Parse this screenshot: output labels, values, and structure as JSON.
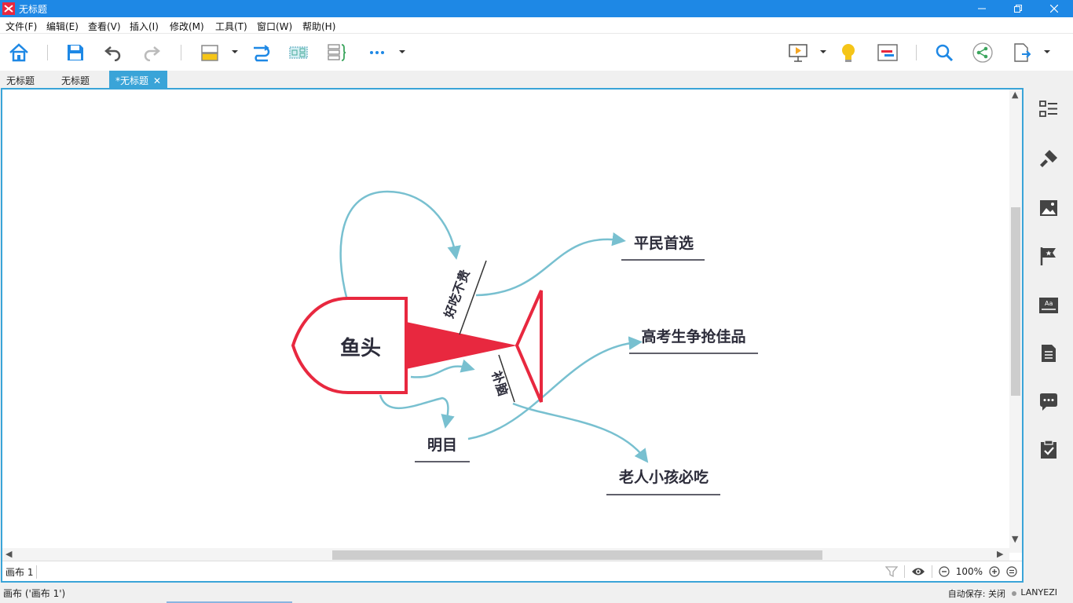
{
  "window": {
    "title": "无标题",
    "controls": [
      "minimize",
      "maximize",
      "close"
    ]
  },
  "menu": {
    "items": [
      "文件(F)",
      "编辑(E)",
      "查看(V)",
      "插入(I)",
      "修改(M)",
      "工具(T)",
      "窗口(W)",
      "帮助(H)"
    ]
  },
  "toolbar": {
    "buttons": [
      "home-icon",
      "save-icon",
      "undo-icon",
      "redo-icon",
      "topic-icon",
      "relationship-icon",
      "summary-icon",
      "boundary-icon",
      "more-icon",
      "presentation-icon",
      "idea-icon",
      "gantt-icon",
      "search-icon",
      "share-icon",
      "export-icon"
    ]
  },
  "tabs": [
    {
      "label": "无标题",
      "active": false
    },
    {
      "label": "无标题",
      "active": false
    },
    {
      "label": "*无标题",
      "active": true
    }
  ],
  "mindmap": {
    "central_topic": "鱼头",
    "bones": [
      {
        "label": "好吃不贵"
      },
      {
        "label": "补脑"
      }
    ],
    "topics": [
      {
        "label": "平民首选"
      },
      {
        "label": "高考生争抢佳品"
      },
      {
        "label": "明目"
      },
      {
        "label": "老人小孩必吃"
      }
    ],
    "colors": {
      "fish": "#e8283f",
      "relationship": "#78c0d0",
      "accent": "#3aa4d8"
    }
  },
  "sheetbar": {
    "sheet_name": "画布 1",
    "zoom": "100%"
  },
  "right_panel": {
    "icons": [
      "outline-icon",
      "format-icon",
      "image-icon",
      "marker-icon",
      "text-icon",
      "notes-icon",
      "comment-icon",
      "task-icon"
    ]
  },
  "status": {
    "canvas": "画布 ('画布 1')",
    "autosave": "自动保存: 关闭",
    "user": "LANYEZI"
  }
}
